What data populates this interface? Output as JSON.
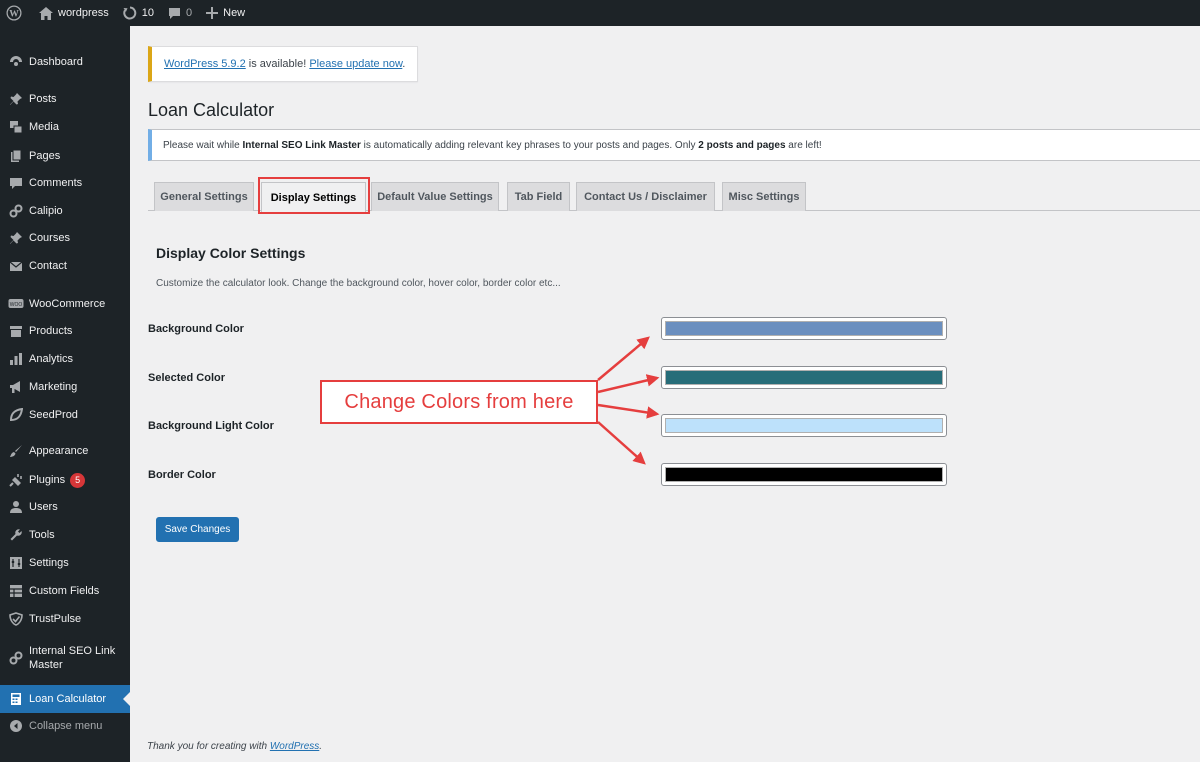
{
  "adminbar": {
    "site_name": "wordpress",
    "updates_count": "10",
    "comments_count": "0",
    "new_label": "New"
  },
  "sidebar": {
    "items": [
      {
        "label": "Dashboard",
        "icon": "dashboard-icon"
      },
      {
        "label": "Posts",
        "icon": "pin-icon"
      },
      {
        "label": "Media",
        "icon": "media-icon"
      },
      {
        "label": "Pages",
        "icon": "pages-icon"
      },
      {
        "label": "Comments",
        "icon": "comment-icon"
      },
      {
        "label": "Calipio",
        "icon": "link-icon"
      },
      {
        "label": "Courses",
        "icon": "pin-icon"
      },
      {
        "label": "Contact",
        "icon": "mail-icon"
      },
      {
        "label": "WooCommerce",
        "icon": "woo-icon"
      },
      {
        "label": "Products",
        "icon": "archive-icon"
      },
      {
        "label": "Analytics",
        "icon": "bar-chart-icon"
      },
      {
        "label": "Marketing",
        "icon": "megaphone-icon"
      },
      {
        "label": "SeedProd",
        "icon": "leaf-icon"
      },
      {
        "label": "Appearance",
        "icon": "brush-icon"
      },
      {
        "label": "Plugins",
        "icon": "plug-icon",
        "badge": "5"
      },
      {
        "label": "Users",
        "icon": "user-icon"
      },
      {
        "label": "Tools",
        "icon": "wrench-icon"
      },
      {
        "label": "Settings",
        "icon": "settings-icon"
      },
      {
        "label": "Custom Fields",
        "icon": "grid-icon"
      },
      {
        "label": "TrustPulse",
        "icon": "shield-icon"
      },
      {
        "label": "Internal SEO Link Master",
        "icon": "link-icon"
      },
      {
        "label": "Loan Calculator",
        "icon": "calculator-icon",
        "current": true
      },
      {
        "label": "Collapse menu",
        "icon": "collapse-icon"
      }
    ]
  },
  "notice_update": {
    "link1": "WordPress 5.9.2",
    "middle": " is available! ",
    "link2": "Please update now",
    "end": "."
  },
  "page_title": "Loan Calculator",
  "notice_info": {
    "part1": "Please wait while ",
    "bold1": "Internal SEO Link Master",
    "part2": " is automatically adding relevant key phrases to your posts and pages. Only ",
    "bold2": "2 posts and pages",
    "part3": " are left!"
  },
  "tabs": [
    {
      "label": "General Settings"
    },
    {
      "label": "Display Settings",
      "active": true
    },
    {
      "label": "Default Value Settings"
    },
    {
      "label": "Tab Field"
    },
    {
      "label": "Contact Us / Disclaimer"
    },
    {
      "label": "Misc Settings"
    }
  ],
  "section": {
    "title": "Display Color Settings",
    "description": "Customize the calculator look. Change the background color, hover color, border color etc..."
  },
  "fields": [
    {
      "label": "Background Color",
      "color": "#6b8fbf"
    },
    {
      "label": "Selected Color",
      "color": "#276d79"
    },
    {
      "label": "Background Light Color",
      "color": "#bde1fb"
    },
    {
      "label": "Border Color",
      "color": "#000000"
    }
  ],
  "save_button": "Save Changes",
  "callout_text": "Change Colors from here",
  "footer": {
    "text": "Thank you for creating with ",
    "link": "WordPress",
    "end": "."
  }
}
